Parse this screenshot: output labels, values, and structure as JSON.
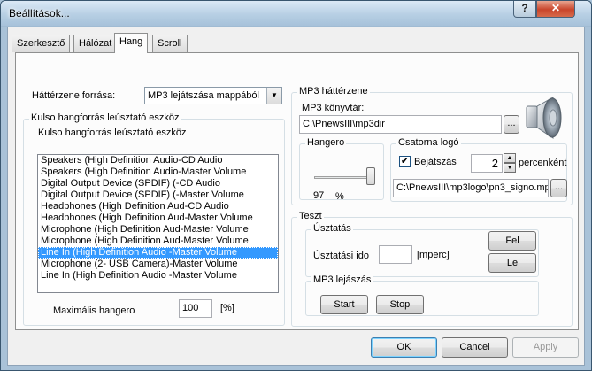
{
  "window": {
    "title": "Beállítások...",
    "help_label": "?",
    "close_label": "✕"
  },
  "tabs": [
    {
      "label": "Szerkesztő"
    },
    {
      "label": "Hálózat"
    },
    {
      "label": "Hang"
    },
    {
      "label": "Scroll"
    }
  ],
  "background_source": {
    "label": "Háttérzene forrása:",
    "selected": "MP3 lejátszása mappából"
  },
  "external_device": {
    "group_title": "Kulso hangforrás leúsztató eszköz",
    "inner_label": "Kulso hangforrás leúsztató eszköz",
    "items": [
      "Speakers (High Definition Audio-CD Audio",
      "Speakers (High Definition Audio-Master Volume",
      "Digital Output Device (SPDIF) (-CD Audio",
      "Digital Output Device (SPDIF) (-Master Volume",
      "Headphones (High Definition Aud-CD Audio",
      "Headphones (High Definition Aud-Master Volume",
      "Microphone (High Definition Aud-Master Volume",
      "Microphone (High Definition Aud-Master Volume",
      "Line In (High Definition Audio -Master Volume",
      "Microphone (2- USB Camera)-Master Volume",
      "Line In (High Definition Audio -Master Volume"
    ],
    "selected_index": 8,
    "max_volume_label": "Maximális hangero",
    "max_volume_value": "100",
    "max_volume_unit": "[%]"
  },
  "mp3": {
    "group_title": "MP3 háttérzene",
    "folder_label": "MP3 könyvtár:",
    "folder_value": "C:\\PnewsIII\\mp3dir",
    "browse_label": "...",
    "speaker_icon": "speaker-icon",
    "volume": {
      "title": "Hangero",
      "value": "97",
      "unit": "%",
      "level": 0.97
    },
    "channel_logo": {
      "title": "Csatorna logó",
      "checkbox_label": "Bejátszás",
      "checked": true,
      "minutes": "2",
      "minutes_label": "percenként",
      "path": "C:\\PnewsIII\\mp3logo\\pn3_signo.mp",
      "browse_label": "..."
    }
  },
  "test": {
    "group_title": "Teszt",
    "fade": {
      "title": "Úsztatás",
      "time_label": "Úsztatási ido",
      "time_value": "",
      "unit": "[mperc]",
      "up_label": "Fel",
      "down_label": "Le"
    },
    "playback": {
      "title": "MP3 lejászás",
      "start_label": "Start",
      "stop_label": "Stop"
    }
  },
  "footer": {
    "ok_label": "OK",
    "cancel_label": "Cancel",
    "apply_label": "Apply"
  }
}
